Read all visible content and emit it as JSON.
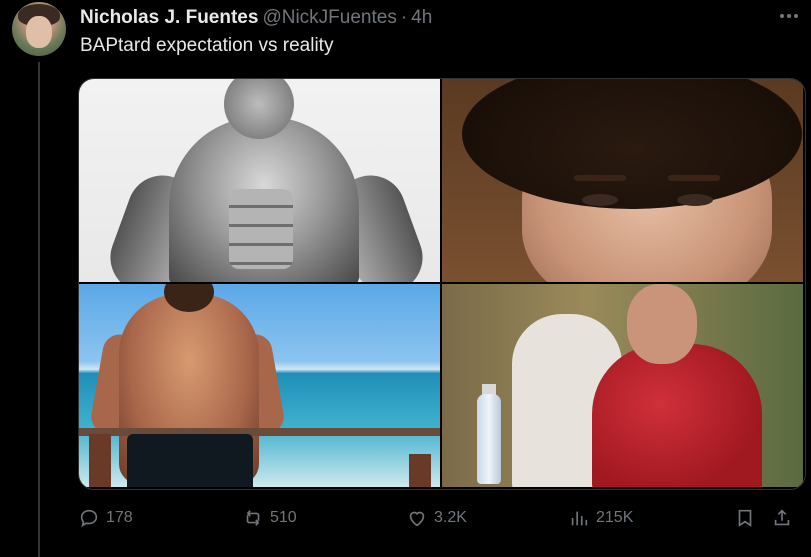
{
  "tweet": {
    "display_name": "Nicholas J. Fuentes",
    "handle": "@NickJFuentes",
    "separator": "·",
    "time": "4h",
    "text": "BAPtard expectation vs reality"
  },
  "media": {
    "images": [
      {
        "description": "expectation-bodybuilder"
      },
      {
        "description": "reality-curly-hair-face"
      },
      {
        "description": "expectation-beach-back"
      },
      {
        "description": "reality-red-shirt"
      }
    ]
  },
  "actions": {
    "replies": "178",
    "reposts": "510",
    "likes": "3.2K",
    "views": "215K"
  },
  "colors": {
    "background": "#000000",
    "text": "#e7e9ea",
    "secondary": "#71767b",
    "border": "#2f3336"
  },
  "icons": {
    "more": "more-icon",
    "reply": "reply-icon",
    "repost": "repost-icon",
    "like": "heart-icon",
    "views": "views-icon",
    "bookmark": "bookmark-icon",
    "share": "share-icon"
  }
}
